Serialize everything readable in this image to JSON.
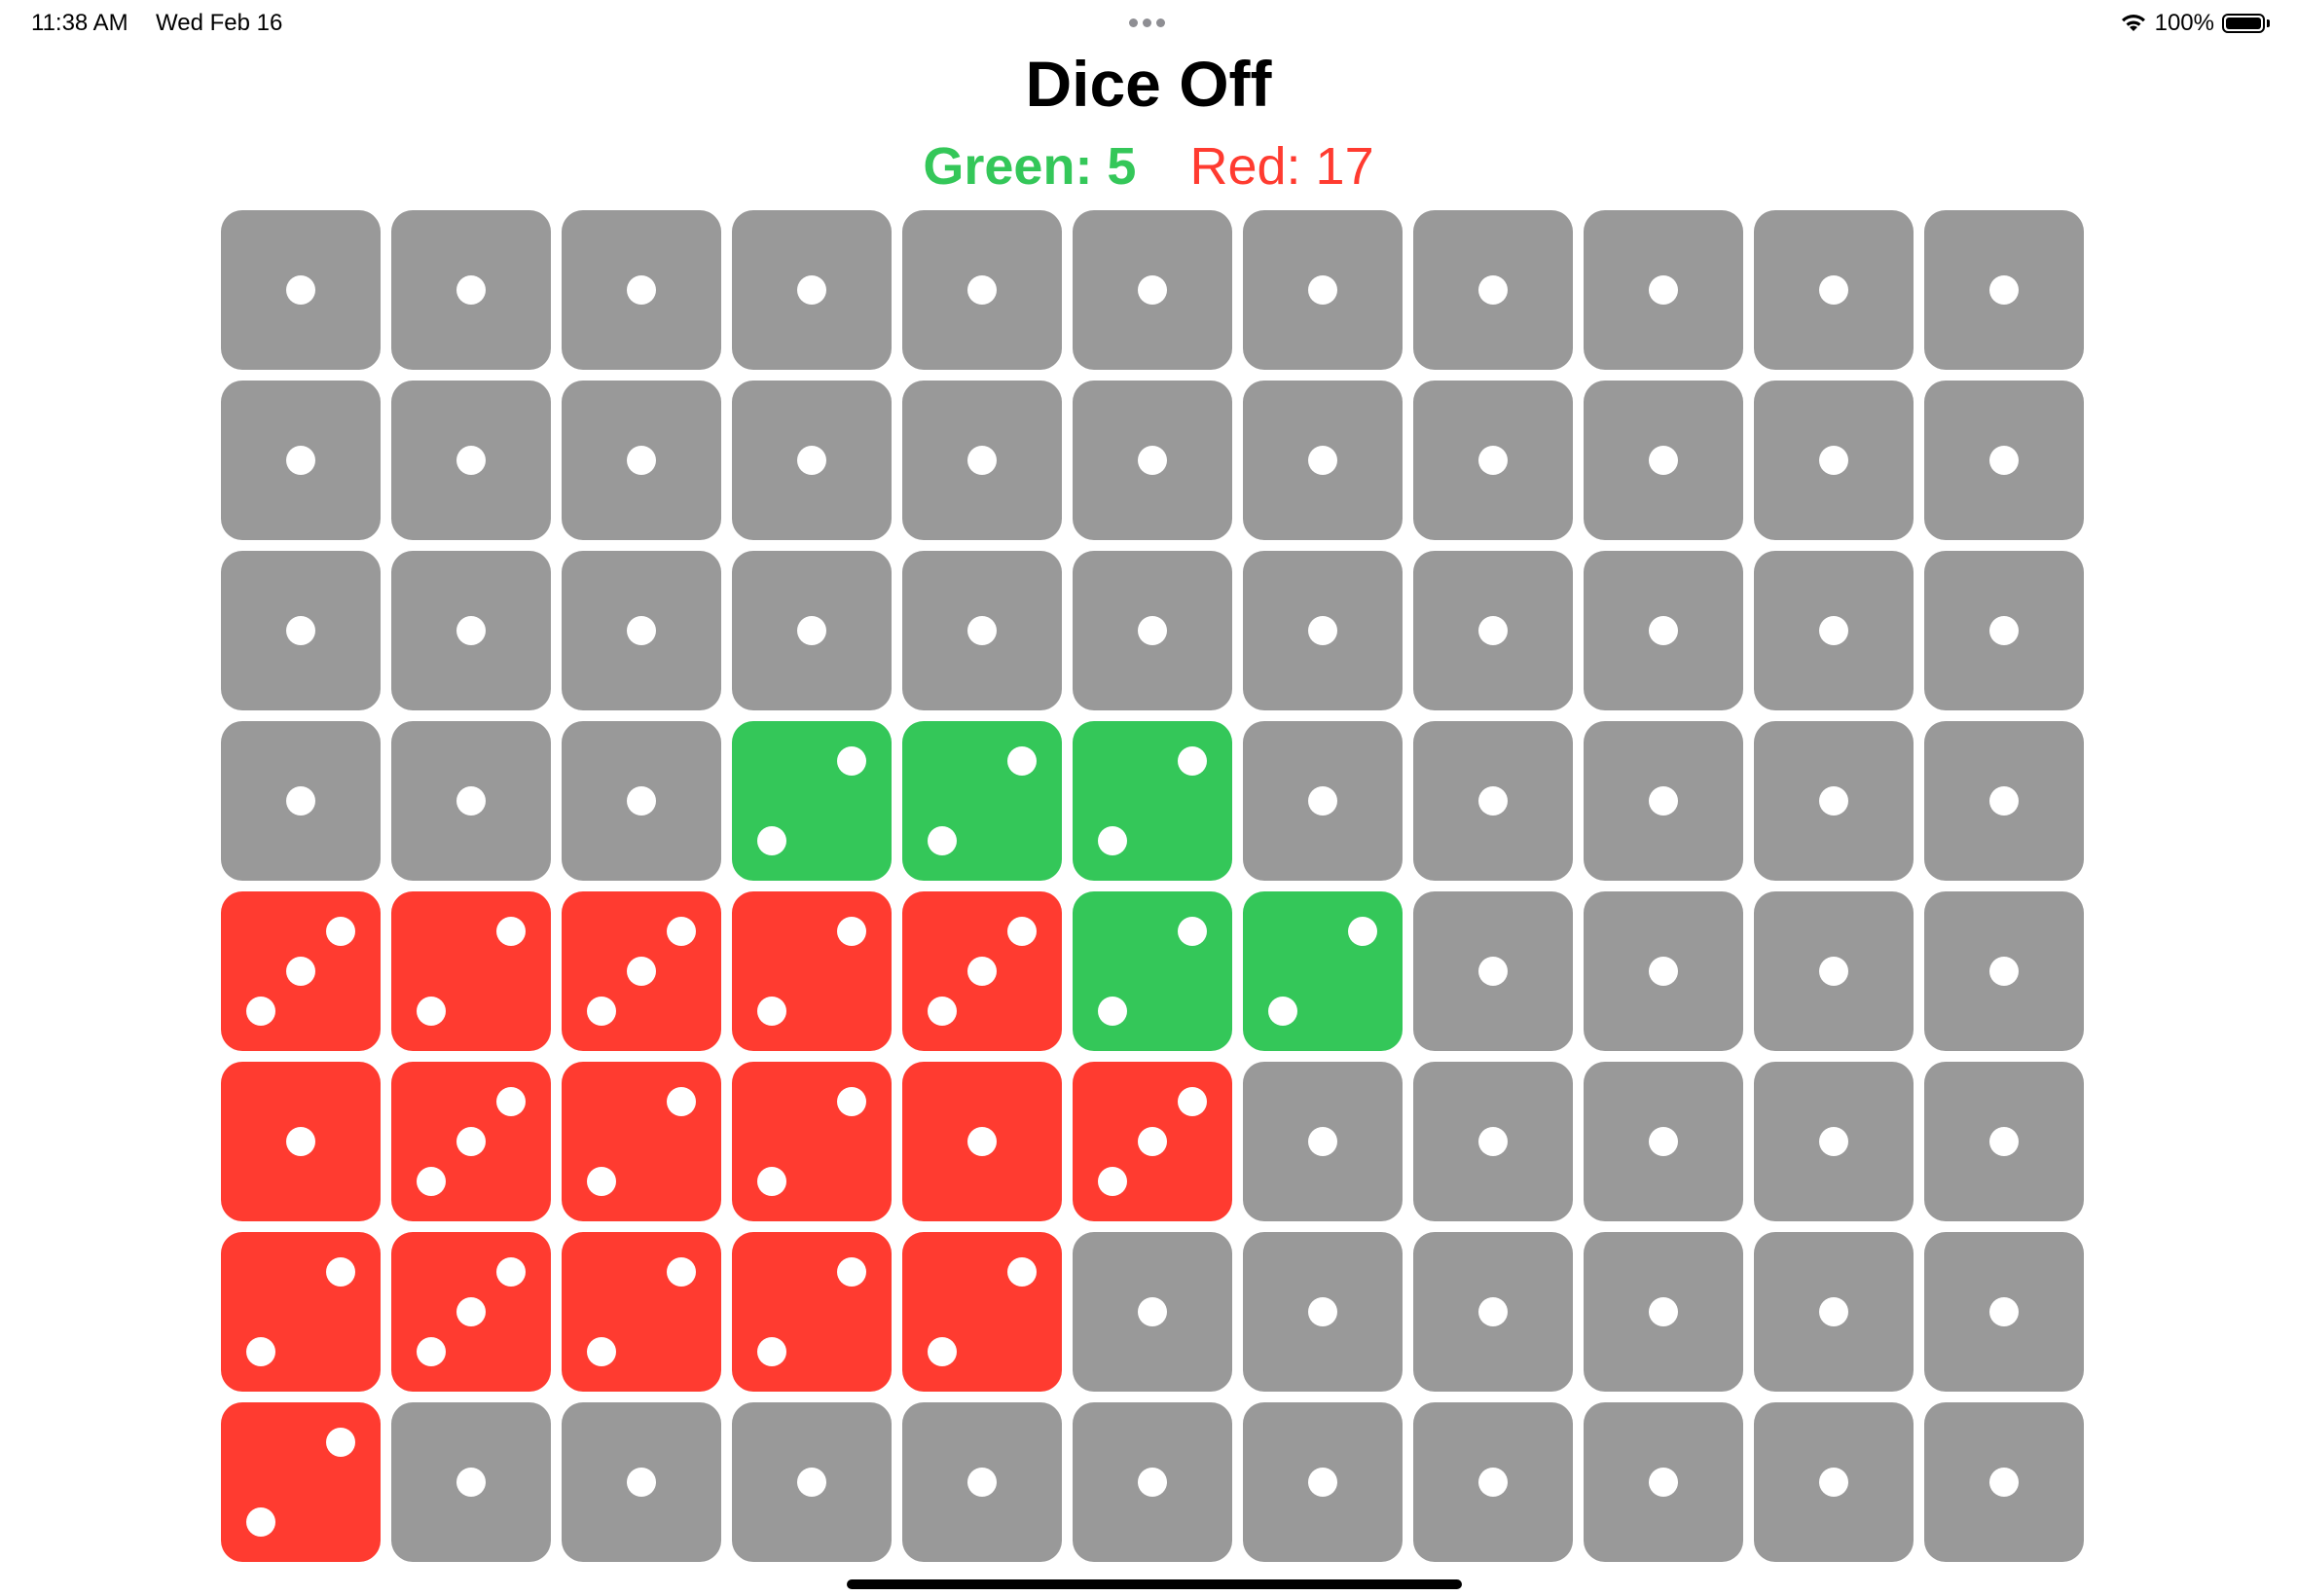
{
  "status_bar": {
    "time": "11:38 AM",
    "date": "Wed Feb 16",
    "battery": "100%",
    "icons": [
      "wifi-icon",
      "battery-icon",
      "multitask-dots-icon"
    ]
  },
  "title": "Dice Off",
  "score": {
    "green_label": "Green: 5",
    "red_label": "Red: 17",
    "green": 5,
    "red": 17
  },
  "colors": {
    "gray": "#999999",
    "green": "#34c759",
    "red": "#ff3b30",
    "pip": "#ffffff"
  },
  "board": {
    "columns": 11,
    "rows": [
      [
        {
          "o": "gray",
          "v": 1
        },
        {
          "o": "gray",
          "v": 1
        },
        {
          "o": "gray",
          "v": 1
        },
        {
          "o": "gray",
          "v": 1
        },
        {
          "o": "gray",
          "v": 1
        },
        {
          "o": "gray",
          "v": 1
        },
        {
          "o": "gray",
          "v": 1
        },
        {
          "o": "gray",
          "v": 1
        },
        {
          "o": "gray",
          "v": 1
        },
        {
          "o": "gray",
          "v": 1
        },
        {
          "o": "gray",
          "v": 1
        }
      ],
      [
        {
          "o": "gray",
          "v": 1
        },
        {
          "o": "gray",
          "v": 1
        },
        {
          "o": "gray",
          "v": 1
        },
        {
          "o": "gray",
          "v": 1
        },
        {
          "o": "gray",
          "v": 1
        },
        {
          "o": "gray",
          "v": 1
        },
        {
          "o": "gray",
          "v": 1
        },
        {
          "o": "gray",
          "v": 1
        },
        {
          "o": "gray",
          "v": 1
        },
        {
          "o": "gray",
          "v": 1
        },
        {
          "o": "gray",
          "v": 1
        }
      ],
      [
        {
          "o": "gray",
          "v": 1
        },
        {
          "o": "gray",
          "v": 1
        },
        {
          "o": "gray",
          "v": 1
        },
        {
          "o": "gray",
          "v": 1
        },
        {
          "o": "gray",
          "v": 1
        },
        {
          "o": "gray",
          "v": 1
        },
        {
          "o": "gray",
          "v": 1
        },
        {
          "o": "gray",
          "v": 1
        },
        {
          "o": "gray",
          "v": 1
        },
        {
          "o": "gray",
          "v": 1
        },
        {
          "o": "gray",
          "v": 1
        }
      ],
      [
        {
          "o": "gray",
          "v": 1
        },
        {
          "o": "gray",
          "v": 1
        },
        {
          "o": "gray",
          "v": 1
        },
        {
          "o": "green",
          "v": 2
        },
        {
          "o": "green",
          "v": 2
        },
        {
          "o": "green",
          "v": 2
        },
        {
          "o": "gray",
          "v": 1
        },
        {
          "o": "gray",
          "v": 1
        },
        {
          "o": "gray",
          "v": 1
        },
        {
          "o": "gray",
          "v": 1
        },
        {
          "o": "gray",
          "v": 1
        }
      ],
      [
        {
          "o": "red",
          "v": 3
        },
        {
          "o": "red",
          "v": 2
        },
        {
          "o": "red",
          "v": 3
        },
        {
          "o": "red",
          "v": 2
        },
        {
          "o": "red",
          "v": 3
        },
        {
          "o": "green",
          "v": 2
        },
        {
          "o": "green",
          "v": 2
        },
        {
          "o": "gray",
          "v": 1
        },
        {
          "o": "gray",
          "v": 1
        },
        {
          "o": "gray",
          "v": 1
        },
        {
          "o": "gray",
          "v": 1
        }
      ],
      [
        {
          "o": "red",
          "v": 1
        },
        {
          "o": "red",
          "v": 3
        },
        {
          "o": "red",
          "v": 2
        },
        {
          "o": "red",
          "v": 2
        },
        {
          "o": "red",
          "v": 1
        },
        {
          "o": "red",
          "v": 3
        },
        {
          "o": "gray",
          "v": 1
        },
        {
          "o": "gray",
          "v": 1
        },
        {
          "o": "gray",
          "v": 1
        },
        {
          "o": "gray",
          "v": 1
        },
        {
          "o": "gray",
          "v": 1
        }
      ],
      [
        {
          "o": "red",
          "v": 2
        },
        {
          "o": "red",
          "v": 3
        },
        {
          "o": "red",
          "v": 2
        },
        {
          "o": "red",
          "v": 2
        },
        {
          "o": "red",
          "v": 2
        },
        {
          "o": "gray",
          "v": 1
        },
        {
          "o": "gray",
          "v": 1
        },
        {
          "o": "gray",
          "v": 1
        },
        {
          "o": "gray",
          "v": 1
        },
        {
          "o": "gray",
          "v": 1
        },
        {
          "o": "gray",
          "v": 1
        }
      ],
      [
        {
          "o": "red",
          "v": 2
        },
        {
          "o": "gray",
          "v": 1
        },
        {
          "o": "gray",
          "v": 1
        },
        {
          "o": "gray",
          "v": 1
        },
        {
          "o": "gray",
          "v": 1
        },
        {
          "o": "gray",
          "v": 1
        },
        {
          "o": "gray",
          "v": 1
        },
        {
          "o": "gray",
          "v": 1
        },
        {
          "o": "gray",
          "v": 1
        },
        {
          "o": "gray",
          "v": 1
        },
        {
          "o": "gray",
          "v": 1
        }
      ]
    ]
  }
}
